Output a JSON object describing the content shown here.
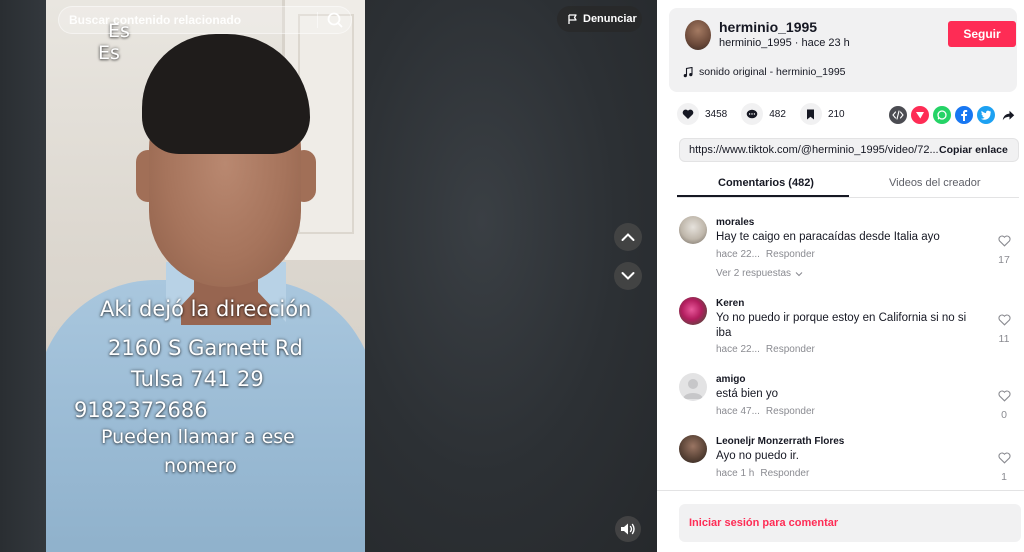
{
  "search": {
    "placeholder": "Buscar contenido relacionado"
  },
  "report_label": "Denunciar",
  "video_overlay": {
    "es_1": "Es",
    "es_2": "Es",
    "line_1": "Aki dejó la dirección",
    "line_2": "2160 S Garnett Rd",
    "line_3": "Tulsa 741 29",
    "line_4": "9182372686",
    "line_5": "Pueden llamar a ese",
    "line_6": "nomero"
  },
  "author": {
    "username": "herminio_1995",
    "handle": "herminio_1995",
    "separator": "·",
    "time": "hace 23 h",
    "follow_label": "Seguir",
    "music": "sonido original - herminio_1995"
  },
  "stats": {
    "likes": "3458",
    "comments": "482",
    "saves": "210"
  },
  "share_icons": [
    "embed-icon",
    "share-arrow-red-icon",
    "whatsapp-icon",
    "facebook-icon",
    "twitter-icon",
    "forward-icon"
  ],
  "link": {
    "url": "https://www.tiktok.com/@herminio_1995/video/72...",
    "copy_label": "Copiar enlace"
  },
  "tabs": {
    "comments": "Comentarios (482)",
    "creator_videos": "Videos del creador"
  },
  "comments": [
    {
      "user": "morales",
      "text": "Hay te caigo en paracaídas desde Italia ayo",
      "time": "hace 22...",
      "reply": "Responder",
      "likes": "17",
      "replies": "Ver 2 respuestas"
    },
    {
      "user": "Keren",
      "text": "Yo no puedo ir porque estoy en California si no si iba",
      "time": "hace 22...",
      "reply": "Responder",
      "likes": "11"
    },
    {
      "user": "amigo",
      "text": "está bien yo",
      "time": "hace 47...",
      "reply": "Responder",
      "likes": "0"
    },
    {
      "user": "Leoneljr Monzerrath Flores",
      "text": "Ayo no puedo ir.",
      "time": "hace 1 h",
      "reply": "Responder",
      "likes": "1"
    }
  ],
  "login_prompt": "Iniciar sesión para comentar",
  "colors": {
    "accent": "#fe2c55",
    "panel_bg": "#ffffff",
    "card_bg": "#f1f1f2",
    "text": "#161823",
    "muted": "#8a8b91"
  }
}
